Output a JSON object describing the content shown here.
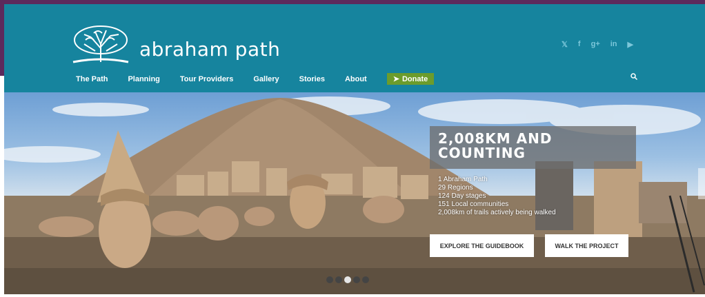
{
  "brand": {
    "name": "abraham path",
    "logo_icon": "tree-icon"
  },
  "social": [
    {
      "icon": "twitter-icon",
      "glyph": "✉"
    },
    {
      "icon": "facebook-icon",
      "glyph": "f"
    },
    {
      "icon": "google-plus-icon",
      "glyph": "g+"
    },
    {
      "icon": "linkedin-icon",
      "glyph": "in"
    },
    {
      "icon": "youtube-icon",
      "glyph": "▶"
    }
  ],
  "nav": {
    "items": [
      {
        "label": "The Path"
      },
      {
        "label": "Planning"
      },
      {
        "label": "Tour Providers"
      },
      {
        "label": "Gallery"
      },
      {
        "label": "Stories"
      },
      {
        "label": "About"
      }
    ],
    "donate_label": "Donate"
  },
  "hero": {
    "title": "2,008KM AND COUNTING",
    "stats": [
      "1 Abraham Path",
      "29 Regions",
      "124 Day stages",
      "151 Local communities",
      "2,008km of trails actively being walked"
    ],
    "btn_guidebook": "EXPLORE THE GUIDEBOOK",
    "btn_walk": "WALK THE PROJECT",
    "slide_count": 5,
    "active_slide": 2
  },
  "colors": {
    "header": "#16849e",
    "frame": "#5c2a5c",
    "donate": "#6c9c2c"
  }
}
